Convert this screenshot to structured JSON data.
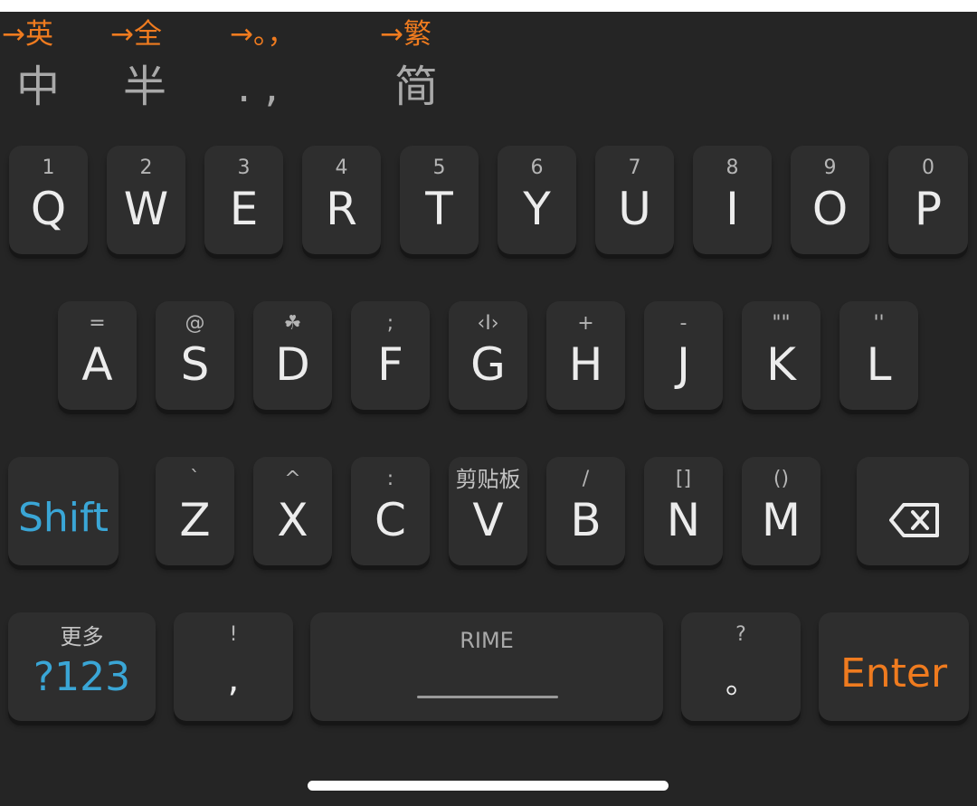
{
  "status_bar": {
    "indicators": [
      {
        "next": "→英",
        "current": "中"
      },
      {
        "next": "→全",
        "current": "半"
      },
      {
        "next": "→。，",
        "current": ". ,"
      },
      {
        "next": "→繁",
        "current": "简"
      }
    ]
  },
  "rows": {
    "row1": [
      {
        "hint": "1",
        "label": "Q"
      },
      {
        "hint": "2",
        "label": "W"
      },
      {
        "hint": "3",
        "label": "E"
      },
      {
        "hint": "4",
        "label": "R"
      },
      {
        "hint": "5",
        "label": "T"
      },
      {
        "hint": "6",
        "label": "Y"
      },
      {
        "hint": "7",
        "label": "U"
      },
      {
        "hint": "8",
        "label": "I"
      },
      {
        "hint": "9",
        "label": "O"
      },
      {
        "hint": "0",
        "label": "P"
      }
    ],
    "row2": [
      {
        "hint": "=",
        "label": "A"
      },
      {
        "hint": "@",
        "label": "S"
      },
      {
        "hint": "☘",
        "label": "D"
      },
      {
        "hint": ";",
        "label": "F"
      },
      {
        "hint": "‹I›",
        "label": "G"
      },
      {
        "hint": "+",
        "label": "H"
      },
      {
        "hint": "-",
        "label": "J"
      },
      {
        "hint": "\"\"",
        "label": "K"
      },
      {
        "hint": "''",
        "label": "L"
      }
    ],
    "row3": [
      {
        "hint": "`",
        "label": "Z"
      },
      {
        "hint": "^",
        "label": "X"
      },
      {
        "hint": ":",
        "label": "C"
      },
      {
        "hint": "剪贴板",
        "label": "V"
      },
      {
        "hint": "/",
        "label": "B"
      },
      {
        "hint": "[]",
        "label": "N"
      },
      {
        "hint": "()",
        "label": "M"
      }
    ]
  },
  "special_keys": {
    "shift_label": "Shift",
    "backspace_icon": "backspace-icon",
    "mode_hint": "更多",
    "mode_label": "?123",
    "comma_hint": "!",
    "comma_label": ",",
    "space_label": "RIME",
    "period_hint": "?",
    "period_label": "。",
    "enter_label": "Enter"
  },
  "colors": {
    "accent_blue": "#3aa6d6",
    "accent_orange": "#ef7b1f",
    "key_bg": "#2e2e2e",
    "keyboard_bg": "#252525"
  }
}
